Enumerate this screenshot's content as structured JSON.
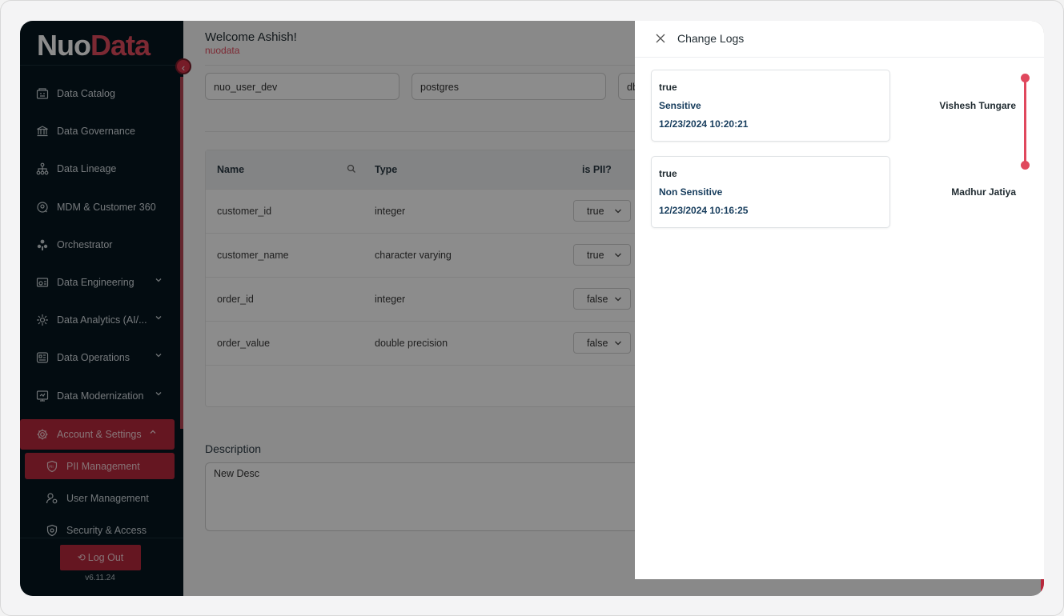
{
  "brand": {
    "name_part1": "Nuo",
    "name_part2": "Data",
    "accent_color": "#e24b5e"
  },
  "sidebar": {
    "items": [
      {
        "label": "Data Catalog",
        "icon": "catalog-icon"
      },
      {
        "label": "Data Governance",
        "icon": "governance-icon"
      },
      {
        "label": "Data Lineage",
        "icon": "lineage-icon"
      },
      {
        "label": "MDM & Customer 360",
        "icon": "mdm-icon"
      },
      {
        "label": "Orchestrator",
        "icon": "orchestrator-icon"
      },
      {
        "label": "Data Engineering",
        "icon": "engineering-icon",
        "expandable": true
      },
      {
        "label": "Data Analytics (AI/...",
        "icon": "analytics-icon",
        "expandable": true
      },
      {
        "label": "Data Operations",
        "icon": "operations-icon",
        "expandable": true
      },
      {
        "label": "Data Modernization",
        "icon": "modernization-icon",
        "expandable": true
      },
      {
        "label": "Account & Settings",
        "icon": "settings-icon",
        "expanded": true,
        "active": true
      }
    ],
    "sub_items": [
      {
        "label": "PII Management",
        "icon": "pii-icon",
        "active": true
      },
      {
        "label": "User Management",
        "icon": "user-management-icon"
      },
      {
        "label": "Security & Access",
        "icon": "security-icon"
      }
    ],
    "logout_label": "Log Out",
    "version": "v6.11.24"
  },
  "main": {
    "welcome": "Welcome Ashish!",
    "org": "nuodata",
    "fields": [
      "nuo_user_dev",
      "postgres",
      "db"
    ],
    "table": {
      "headers": {
        "name": "Name",
        "type": "Type",
        "pii": "is PII?"
      },
      "rows": [
        {
          "name": "customer_id",
          "type": "integer",
          "pii": "true"
        },
        {
          "name": "customer_name",
          "type": "character varying",
          "pii": "true"
        },
        {
          "name": "order_id",
          "type": "integer",
          "pii": "false"
        },
        {
          "name": "order_value",
          "type": "double precision",
          "pii": "false"
        }
      ]
    },
    "description_label": "Description",
    "description_value": "New Desc"
  },
  "drawer": {
    "title": "Change Logs",
    "logs": [
      {
        "value": "true",
        "classification": "Sensitive",
        "timestamp": "12/23/2024 10:20:21",
        "user": "Vishesh Tungare"
      },
      {
        "value": "true",
        "classification": "Non Sensitive",
        "timestamp": "12/23/2024 10:16:25",
        "user": "Madhur Jatiya"
      }
    ],
    "timeline_color": "#e0485d"
  }
}
